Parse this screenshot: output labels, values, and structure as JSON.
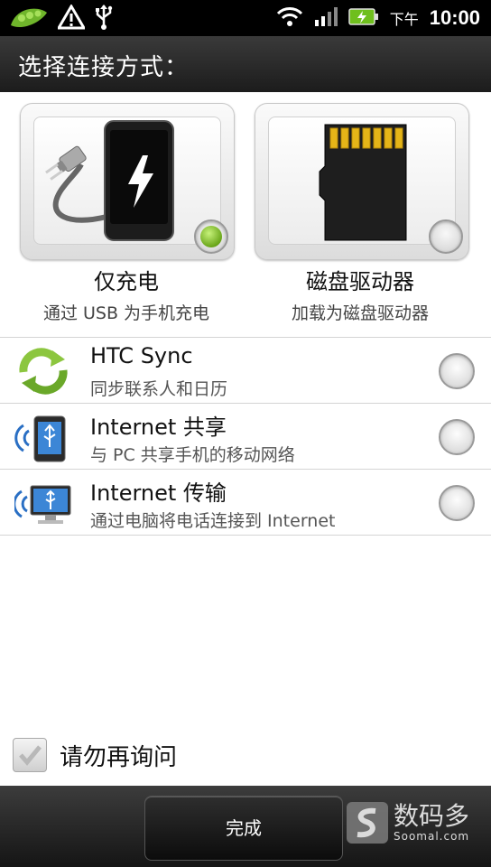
{
  "status_bar": {
    "ampm": "下午",
    "time": "10:00",
    "icons": [
      "pea-icon",
      "warning-icon",
      "usb-icon",
      "wifi-icon",
      "signal-icon",
      "battery-charging-icon"
    ]
  },
  "dialog": {
    "title": "选择连接方式："
  },
  "cards": [
    {
      "label": "仅充电",
      "sub": "通过 USB 为手机充电",
      "icon": "charging-phone-icon",
      "selected": true
    },
    {
      "label": "磁盘驱动器",
      "sub": "加载为磁盘驱动器",
      "icon": "sd-card-icon",
      "selected": false
    }
  ],
  "options": [
    {
      "title": "HTC Sync",
      "sub": "同步联系人和日历",
      "icon": "sync-icon",
      "selected": false
    },
    {
      "title": "Internet 共享",
      "sub": "与 PC 共享手机的移动网络",
      "icon": "phone-share-icon",
      "selected": false
    },
    {
      "title": "Internet 传输",
      "sub": "通过电脑将电话连接到 Internet",
      "icon": "pc-share-icon",
      "selected": false
    }
  ],
  "dont_ask": {
    "label": "请勿再询问",
    "checked": false
  },
  "bottom": {
    "done_label": "完成"
  },
  "watermark": {
    "cn": "数码多",
    "en": "Soomal.com"
  },
  "colors": {
    "selected_green": "#7cc52a",
    "title_bar": "#2a2a2a"
  }
}
